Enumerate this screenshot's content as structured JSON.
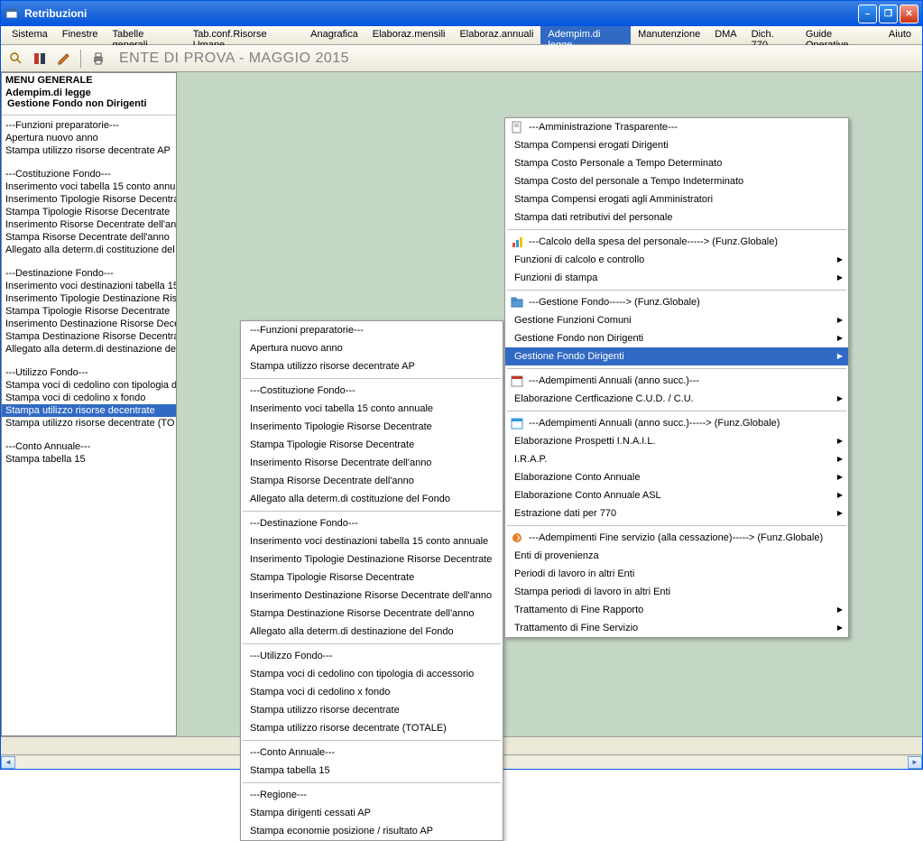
{
  "window": {
    "title": "Retribuzioni"
  },
  "menubar": [
    "Sistema",
    "Finestre",
    "Tabelle generali",
    "Tab.conf.Risorse Umane",
    "Anagrafica",
    "Elaboraz.mensili",
    "Elaboraz.annuali",
    "Adempim.di legge",
    "Manutenzione",
    "DMA",
    "Dich. 770",
    "Guide Operative",
    "Aiuto"
  ],
  "menubar_active": 7,
  "breadcrumb": "ENTE DI PROVA - MAGGIO 2015",
  "sidebar": {
    "title": "MENU GENERALE",
    "sub1": "Adempim.di legge",
    "sub2": "Gestione Fondo non Dirigenti",
    "groups": [
      [
        "---Funzioni preparatorie---",
        "Apertura nuovo anno",
        "Stampa utilizzo risorse decentrate AP"
      ],
      [
        "---Costituzione Fondo---",
        "Inserimento voci tabella 15 conto annu",
        "Inserimento Tipologie Risorse Decentra",
        "Stampa Tipologie Risorse Decentrate",
        "Inserimento Risorse Decentrate dell'an",
        "Stampa Risorse Decentrate dell'anno",
        "Allegato alla determ.di costituzione del"
      ],
      [
        "---Destinazione Fondo---",
        "Inserimento voci destinazioni tabella 15",
        "Inserimento Tipologie Destinazione Ris",
        "Stampa Tipologie Risorse Decentrate",
        "Inserimento Destinazione Risorse Dece",
        "Stampa Destinazione Risorse Decentra",
        "Allegato alla determ.di destinazione de"
      ],
      [
        "---Utilizzo Fondo---",
        "Stampa voci di cedolino con tipologia d",
        "Stampa voci di cedolino x fondo",
        "Stampa utilizzo risorse decentrate",
        "Stampa utilizzo risorse decentrate (TO"
      ],
      [
        "---Conto Annuale---",
        "Stampa tabella 15"
      ]
    ],
    "selected": "Stampa utilizzo risorse decentrate"
  },
  "popup1": [
    [
      "---Funzioni preparatorie---",
      "Apertura nuovo anno",
      "Stampa utilizzo risorse decentrate AP"
    ],
    [
      "---Costituzione Fondo---",
      "Inserimento voci tabella 15 conto annuale",
      "Inserimento Tipologie Risorse Decentrate",
      "Stampa Tipologie Risorse Decentrate",
      "Inserimento Risorse Decentrate dell'anno",
      "Stampa Risorse Decentrate dell'anno",
      "Allegato alla determ.di costituzione del Fondo"
    ],
    [
      "---Destinazione Fondo---",
      "Inserimento voci destinazioni tabella 15 conto annuale",
      "Inserimento Tipologie Destinazione Risorse Decentrate",
      "Stampa Tipologie Risorse Decentrate",
      "Inserimento Destinazione Risorse Decentrate dell'anno",
      "Stampa Destinazione Risorse Decentrate dell'anno",
      "Allegato alla determ.di destinazione del Fondo"
    ],
    [
      "---Utilizzo Fondo---",
      "Stampa voci di cedolino con tipologia di accessorio",
      "Stampa voci di cedolino x fondo",
      "Stampa utilizzo risorse decentrate",
      "Stampa utilizzo risorse decentrate (TOTALE)"
    ],
    [
      "---Conto Annuale---",
      "Stampa tabella 15"
    ],
    [
      "---Regione---",
      "Stampa dirigenti cessati AP",
      "Stampa economie posizione / risultato AP"
    ]
  ],
  "popup2": {
    "items": [
      {
        "t": "---Amministrazione Trasparente---",
        "icon": "page"
      },
      {
        "t": "Stampa Compensi erogati Dirigenti"
      },
      {
        "t": "Stampa Costo Personale a Tempo Determinato"
      },
      {
        "t": "Stampa Costo del personale a Tempo Indeterminato"
      },
      {
        "t": "Stampa Compensi erogati agli Amministratori"
      },
      {
        "t": "Stampa dati retributivi del personale"
      },
      {
        "sep": true
      },
      {
        "t": "---Calcolo della spesa del personale-----> (Funz.Globale)",
        "icon": "chart"
      },
      {
        "t": "Funzioni di calcolo e controllo",
        "arrow": true
      },
      {
        "t": "Funzioni di stampa",
        "arrow": true
      },
      {
        "sep": true
      },
      {
        "t": "---Gestione Fondo-----> (Funz.Globale)",
        "icon": "folder"
      },
      {
        "t": "Gestione Funzioni Comuni",
        "arrow": true
      },
      {
        "t": "Gestione Fondo non Dirigenti",
        "arrow": true
      },
      {
        "t": "Gestione Fondo Dirigenti",
        "arrow": true,
        "highlight": true
      },
      {
        "sep": true
      },
      {
        "t": "---Adempimenti Annuali (anno succ.)---",
        "icon": "cal"
      },
      {
        "t": "Elaborazione Certficazione C.U.D. / C.U.",
        "arrow": true
      },
      {
        "sep": true
      },
      {
        "t": "---Adempimenti Annuali (anno succ.)-----> (Funz.Globale)",
        "icon": "cal2"
      },
      {
        "t": "Elaborazione Prospetti I.N.A.I.L.",
        "arrow": true
      },
      {
        "t": "I.R.A.P.",
        "arrow": true
      },
      {
        "t": "Elaborazione Conto Annuale",
        "arrow": true
      },
      {
        "t": "Elaborazione Conto Annuale ASL",
        "arrow": true
      },
      {
        "t": "Estrazione dati per 770",
        "arrow": true
      },
      {
        "sep": true
      },
      {
        "t": "---Adempimenti Fine servizio (alla cessazione)-----> (Funz.Globale)",
        "icon": "exit"
      },
      {
        "t": "Enti di provenienza"
      },
      {
        "t": "Periodi di lavoro in altri Enti"
      },
      {
        "t": "Stampa periodi di lavoro in altri Enti"
      },
      {
        "t": "Trattamento di Fine Rapporto",
        "arrow": true
      },
      {
        "t": "Trattamento di Fine Servizio",
        "arrow": true
      }
    ]
  }
}
